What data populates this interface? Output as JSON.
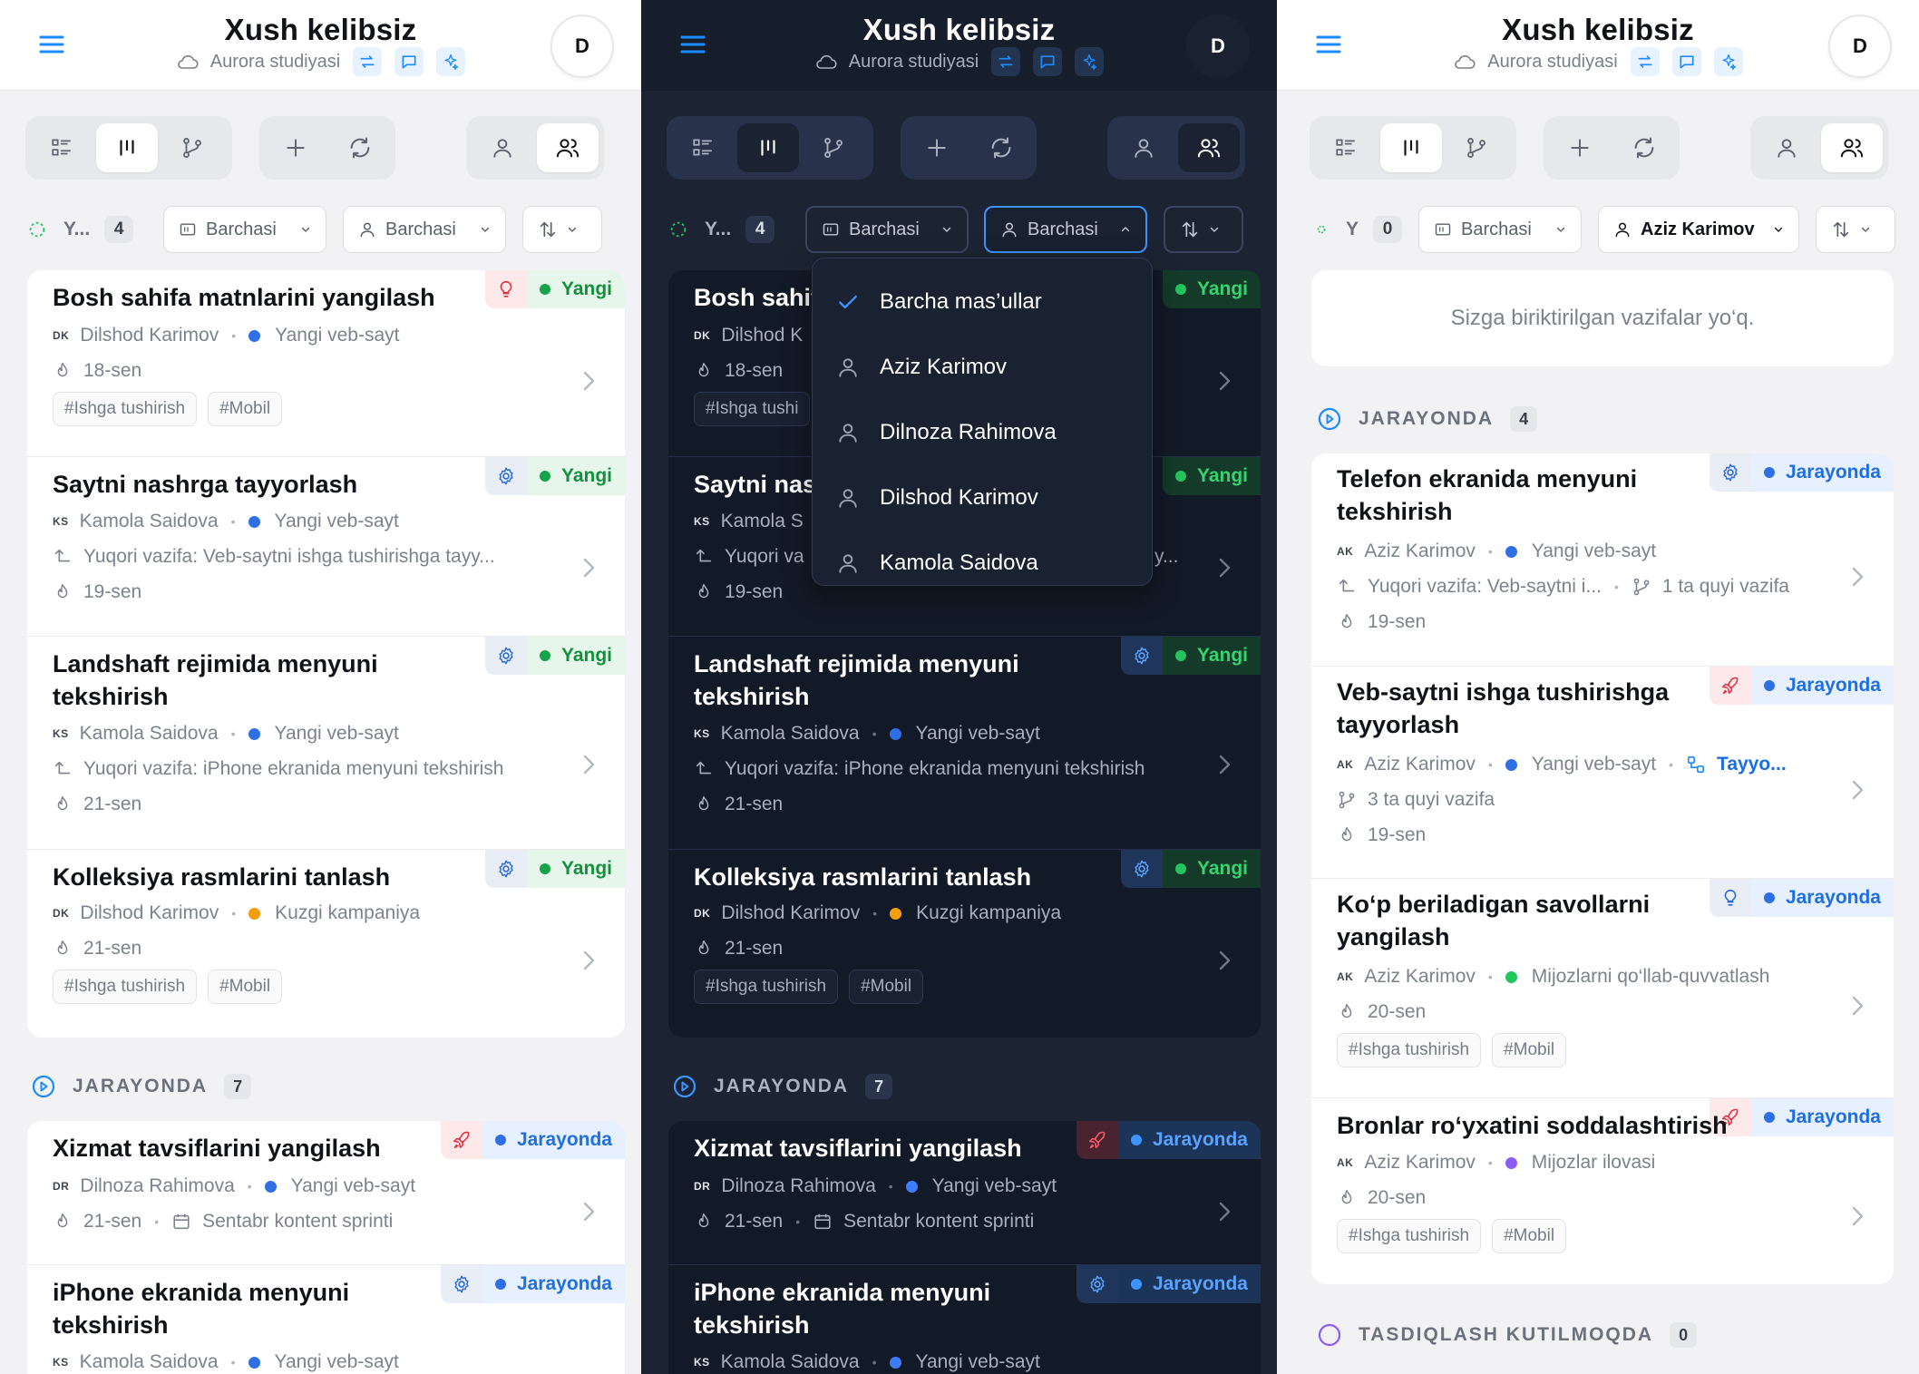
{
  "header": {
    "title": "Xush kelibsiz",
    "subtitle": "Aurora studiyasi",
    "avatar_initial": "D"
  },
  "filters": {
    "all_label": "Barchasi"
  },
  "panels": [
    {
      "theme": "light",
      "status_label": "Y...",
      "status_count": "4",
      "assignee_filter": "Barchasi",
      "new_cards": [
        {
          "title": "Bosh sahifa matnlarini yangilash",
          "initials": "DK",
          "assignee": "Dilshod Karimov",
          "project": "Yangi veb-sayt",
          "due": "18-sen",
          "tags": [
            "#Ishga tushirish",
            "#Mobil"
          ],
          "status": "Yangi"
        },
        {
          "title": "Saytni nashrga tayyorlash",
          "initials": "KS",
          "assignee": "Kamola Saidova",
          "project": "Yangi veb-sayt",
          "parent": "Yuqori vazifa: Veb-saytni ishga tushirishga tayy...",
          "due": "19-sen",
          "status": "Yangi"
        },
        {
          "title": "Landshaft rejimida menyuni tekshirish",
          "initials": "KS",
          "assignee": "Kamola Saidova",
          "project": "Yangi veb-sayt",
          "parent": "Yuqori vazifa: iPhone ekranida menyuni tekshirish",
          "due": "21-sen",
          "status": "Yangi"
        },
        {
          "title": "Kolleksiya rasmlarini tanlash",
          "initials": "DK",
          "assignee": "Dilshod Karimov",
          "project": "Kuzgi kampaniya",
          "due": "21-sen",
          "tags": [
            "#Ishga tushirish",
            "#Mobil"
          ],
          "status": "Yangi"
        }
      ],
      "section_label": "JARAYONDA",
      "section_count": "7",
      "progress_cards": [
        {
          "title": "Xizmat tavsiflarini yangilash",
          "initials": "DR",
          "assignee": "Dilnoza Rahimova",
          "project": "Yangi veb-sayt",
          "due": "21-sen",
          "sprint": "Sentabr kontent sprinti",
          "status": "Jarayonda"
        },
        {
          "title": "iPhone ekranida menyuni tekshirish",
          "initials": "KS",
          "assignee": "Kamola Saidova",
          "project": "Yangi veb-sayt",
          "status": "Jarayonda"
        }
      ]
    },
    {
      "theme": "dark",
      "status_label": "Y...",
      "status_count": "4",
      "assignee_filter": "Barchasi",
      "dropdown": [
        {
          "label": "Barcha mas’ullar",
          "checked": true
        },
        {
          "label": "Aziz Karimov"
        },
        {
          "label": "Dilnoza Rahimova"
        },
        {
          "label": "Dilshod Karimov"
        },
        {
          "label": "Kamola Saidova"
        }
      ],
      "new_cards": [
        {
          "title": "Bosh sahif",
          "initials": "DK",
          "assignee": "Dilshod K",
          "due": "18-sen",
          "tags": [
            "#Ishga tushi"
          ],
          "status": "Yangi"
        },
        {
          "title": "Saytni nas",
          "initials": "KS",
          "assignee": "Kamola S",
          "parent": "Yuqori va",
          "parent_tail": "y...",
          "due": "19-sen",
          "status": "Yangi"
        },
        {
          "title": "Landshaft rejimida menyuni tekshirish",
          "initials": "KS",
          "assignee": "Kamola Saidova",
          "project": "Yangi veb-sayt",
          "parent": "Yuqori vazifa: iPhone ekranida menyuni tekshirish",
          "due": "21-sen",
          "status": "Yangi"
        },
        {
          "title": "Kolleksiya rasmlarini tanlash",
          "initials": "DK",
          "assignee": "Dilshod Karimov",
          "project": "Kuzgi kampaniya",
          "due": "21-sen",
          "tags": [
            "#Ishga tushirish",
            "#Mobil"
          ],
          "status": "Yangi"
        }
      ],
      "section_label": "JARAYONDA",
      "section_count": "7",
      "progress_cards": [
        {
          "title": "Xizmat tavsiflarini yangilash",
          "initials": "DR",
          "assignee": "Dilnoza Rahimova",
          "project": "Yangi veb-sayt",
          "due": "21-sen",
          "sprint": "Sentabr kontent sprinti",
          "status": "Jarayonda"
        },
        {
          "title": "iPhone ekranida menyuni tekshirish",
          "initials": "KS",
          "assignee": "Kamola Saidova",
          "project": "Yangi veb-sayt",
          "status": "Jarayonda"
        }
      ]
    },
    {
      "theme": "light",
      "status_label": "Y",
      "status_count": "0",
      "assignee_filter": "Aziz Karimov",
      "empty_text": "Sizga biriktirilgan vazifalar yo‘q.",
      "section_label": "JARAYONDA",
      "section_count": "4",
      "progress_cards": [
        {
          "title": "Telefon ekranida menyuni tekshirish",
          "initials": "AK",
          "assignee": "Aziz Karimov",
          "project": "Yangi veb-sayt",
          "parent": "Yuqori vazifa: Veb-saytni i...",
          "subtasks": "1 ta quyi vazifa",
          "due": "19-sen",
          "status": "Jarayonda"
        },
        {
          "title": "Veb-saytni ishga tushirishga tayyorlash",
          "initials": "AK",
          "assignee": "Aziz Karimov",
          "project": "Yangi veb-sayt",
          "link": "Tayyo...",
          "subtasks": "3 ta quyi vazifa",
          "due": "19-sen",
          "status": "Jarayonda"
        },
        {
          "title": "Ko‘p beriladigan savollarni yangilash",
          "initials": "AK",
          "assignee": "Aziz Karimov",
          "project": "Mijozlarni qo‘llab-quvvatlash",
          "due": "20-sen",
          "tags": [
            "#Ishga tushirish",
            "#Mobil"
          ],
          "status": "Jarayonda"
        },
        {
          "title": "Bronlar ro‘yxatini soddalashtirish",
          "initials": "AK",
          "assignee": "Aziz Karimov",
          "project": "Mijozlar ilovasi",
          "due": "20-sen",
          "tags": [
            "#Ishga tushirish",
            "#Mobil"
          ],
          "status": "Jarayonda"
        }
      ],
      "section2_label": "TASDIQLASH KUTILMOQDA",
      "section2_count": "0"
    }
  ],
  "colors": {
    "accent": "#1a8cff",
    "project_blue": "#2f6fe4",
    "project_orange": "#f59e0b",
    "project_green": "#22c55e",
    "project_purple": "#8b5cf6"
  }
}
